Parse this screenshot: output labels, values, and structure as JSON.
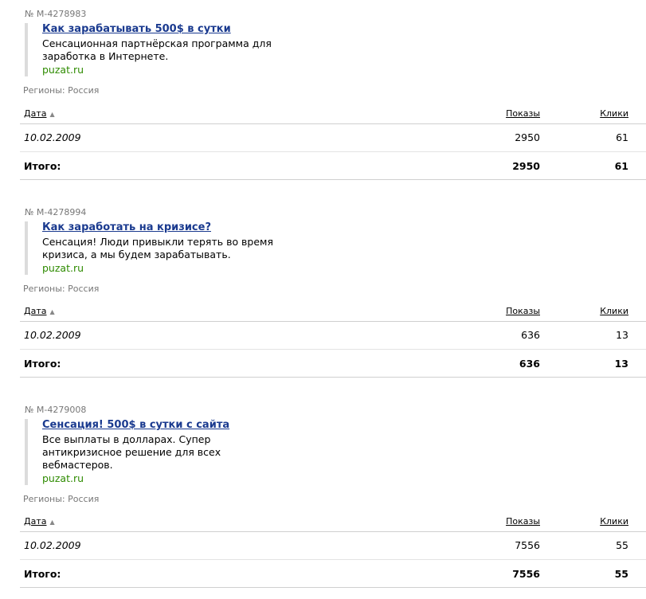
{
  "table_header": {
    "date": "Дата",
    "shows": "Показы",
    "clicks": "Клики",
    "total_label": "Итого:"
  },
  "ads": [
    {
      "id": "№ M-4278983",
      "title": "Как зарабатывать 500$ в сутки",
      "text_lines": [
        "Сенсационная партнёрская программа для",
        "заработка в Интернете."
      ],
      "domain": "puzat.ru",
      "regions": "Регионы: Россия",
      "rows": [
        {
          "date": "10.02.2009",
          "shows": "2950",
          "clicks": "61"
        }
      ],
      "total": {
        "shows": "2950",
        "clicks": "61"
      }
    },
    {
      "id": "№ M-4278994",
      "title": "Как заработать на кризисе?",
      "text_lines": [
        "Сенсация! Люди привыкли терять во время",
        "кризиса, а мы будем зарабатывать."
      ],
      "domain": "puzat.ru",
      "regions": "Регионы: Россия",
      "rows": [
        {
          "date": "10.02.2009",
          "shows": "636",
          "clicks": "13"
        }
      ],
      "total": {
        "shows": "636",
        "clicks": "13"
      }
    },
    {
      "id": "№ M-4279008",
      "title": "Сенсация! 500$ в сутки с сайта",
      "text_lines": [
        "Все выплаты в долларах. Супер",
        "антикризисное решение для всех",
        "вебмастеров."
      ],
      "domain": "puzat.ru",
      "regions": "Регионы: Россия",
      "rows": [
        {
          "date": "10.02.2009",
          "shows": "7556",
          "clicks": "55"
        }
      ],
      "total": {
        "shows": "7556",
        "clicks": "55"
      }
    }
  ]
}
